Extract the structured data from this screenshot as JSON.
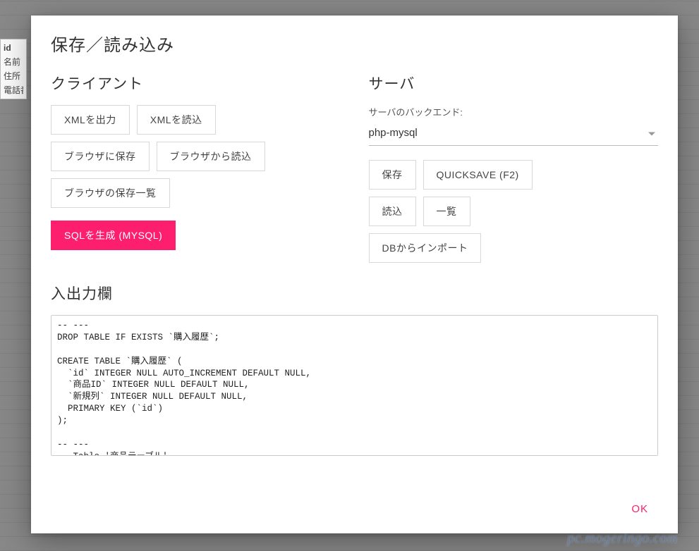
{
  "background": {
    "fields": [
      "id",
      "名前",
      "住所",
      "電話番"
    ]
  },
  "dialog": {
    "title": "保存／読み込み",
    "ok": "OK"
  },
  "client": {
    "title": "クライアント",
    "xml_export": "XMLを出力",
    "xml_import": "XMLを読込",
    "browser_save": "ブラウザに保存",
    "browser_load": "ブラウザから読込",
    "browser_list": "ブラウザの保存一覧",
    "sql_generate": "SQLを生成 (MYSQL)"
  },
  "server": {
    "title": "サーバ",
    "backend_label": "サーバのバックエンド:",
    "backend_value": "php-mysql",
    "save": "保存",
    "quicksave": "QUICKSAVE (F2)",
    "load": "読込",
    "list": "一覧",
    "db_import": "DBからインポート"
  },
  "io": {
    "title": "入出力欄",
    "content": "-- ---\nDROP TABLE IF EXISTS `購入履歴`;\n\t\t\nCREATE TABLE `購入履歴` (\n  `id` INTEGER NULL AUTO_INCREMENT DEFAULT NULL,\n  `商品ID` INTEGER NULL DEFAULT NULL,\n  `新規列` INTEGER NULL DEFAULT NULL,\n  PRIMARY KEY (`id`)\n);\n\n-- ---\n-- Table '商品テーブル'\n--\n-- ---"
  },
  "watermark": "pc.mogeringo.com"
}
